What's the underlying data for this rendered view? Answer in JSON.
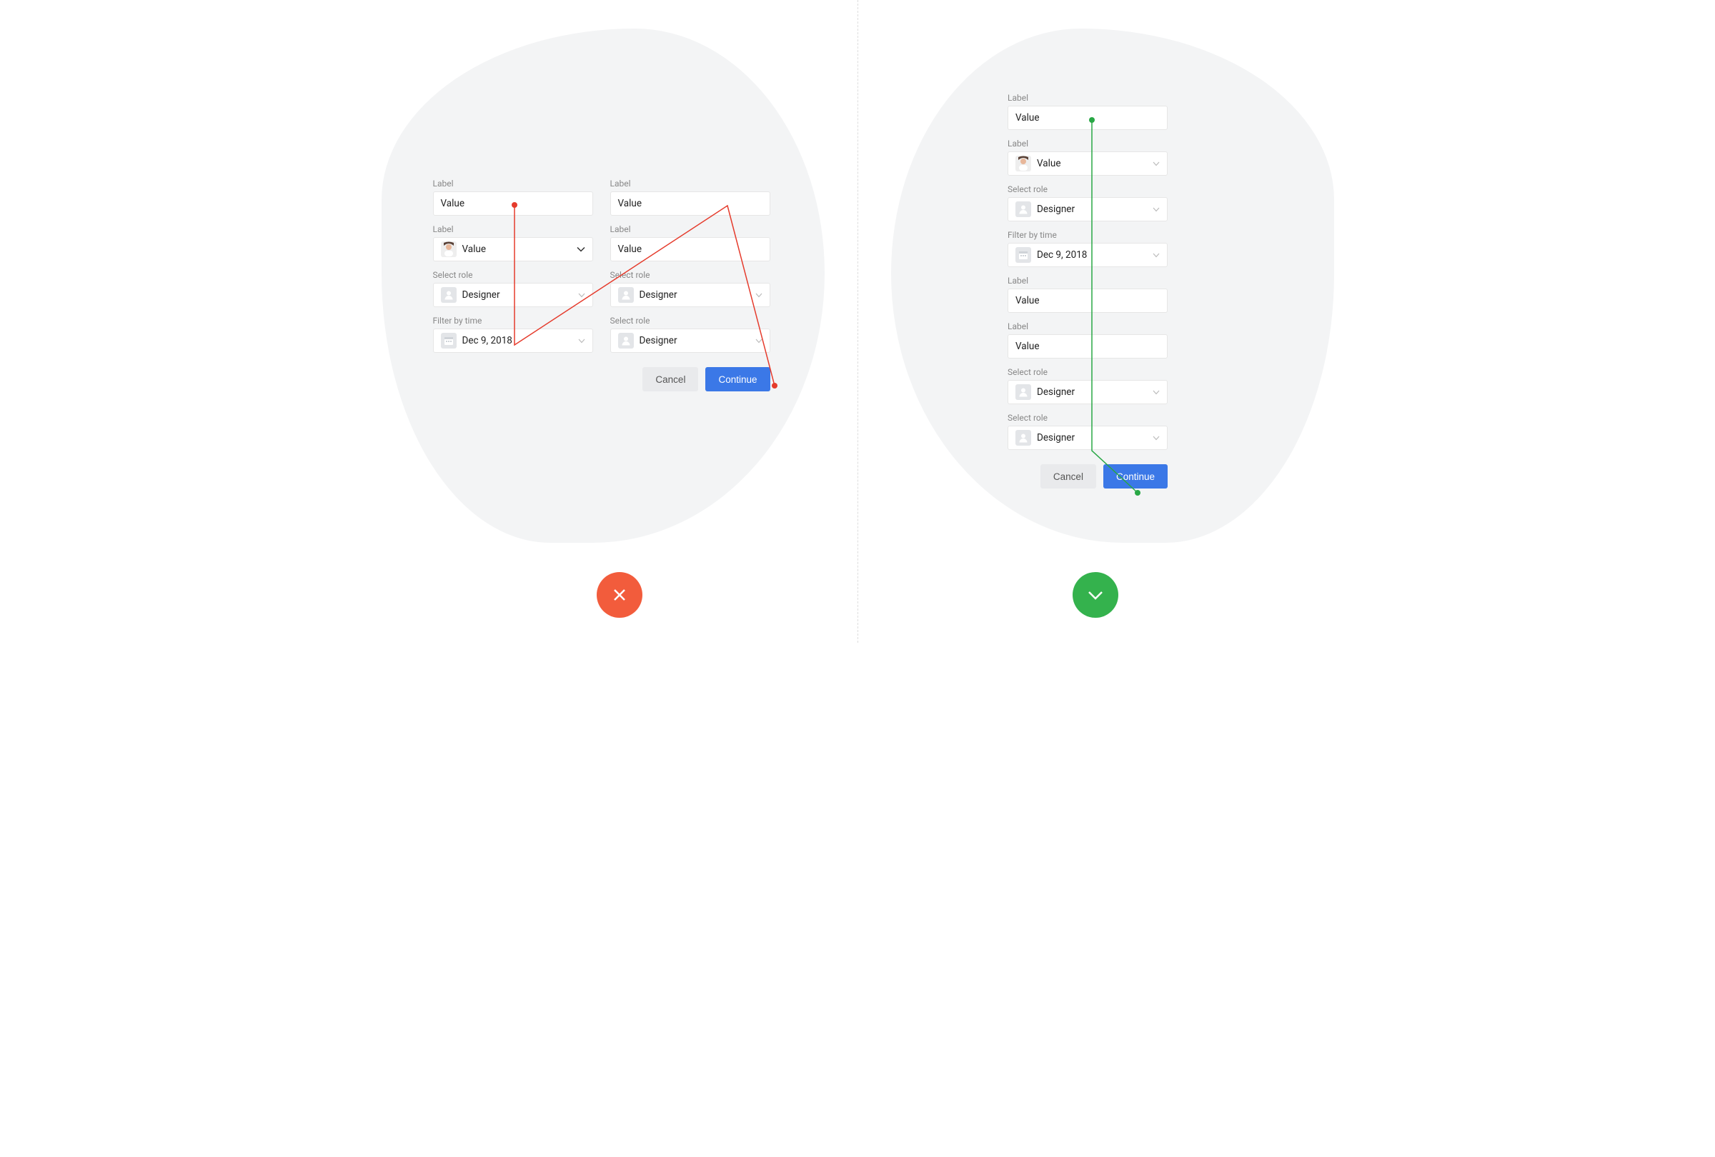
{
  "labels": {
    "label_generic": "Label",
    "select_role": "Select role",
    "filter_time": "Filter by time"
  },
  "values": {
    "value_generic": "Value",
    "role_designer": "Designer",
    "date": "Dec 9, 2018"
  },
  "buttons": {
    "cancel": "Cancel",
    "continue": "Continue"
  }
}
